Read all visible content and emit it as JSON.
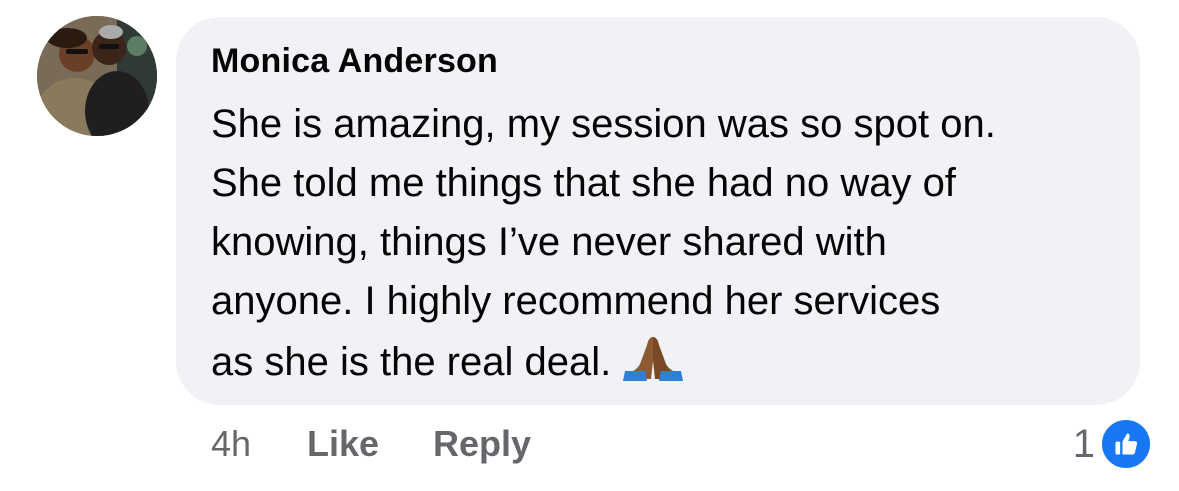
{
  "comment": {
    "author": "Monica Anderson",
    "lines": [
      "She is amazing, my session was so spot on.",
      "She told me things that she had no way of",
      "knowing, things I’ve never shared with",
      "anyone. I highly recommend her services",
      "as she is the real deal."
    ],
    "emoji": "folded-hands-icon",
    "timestamp": "4h",
    "like_label": "Like",
    "reply_label": "Reply",
    "reaction_count": "1",
    "reaction_icon": "thumbs-up-icon"
  },
  "colors": {
    "bubble": "#f0f2f5",
    "text": "#050505",
    "meta": "#65676b",
    "accent": "#1877f2"
  }
}
